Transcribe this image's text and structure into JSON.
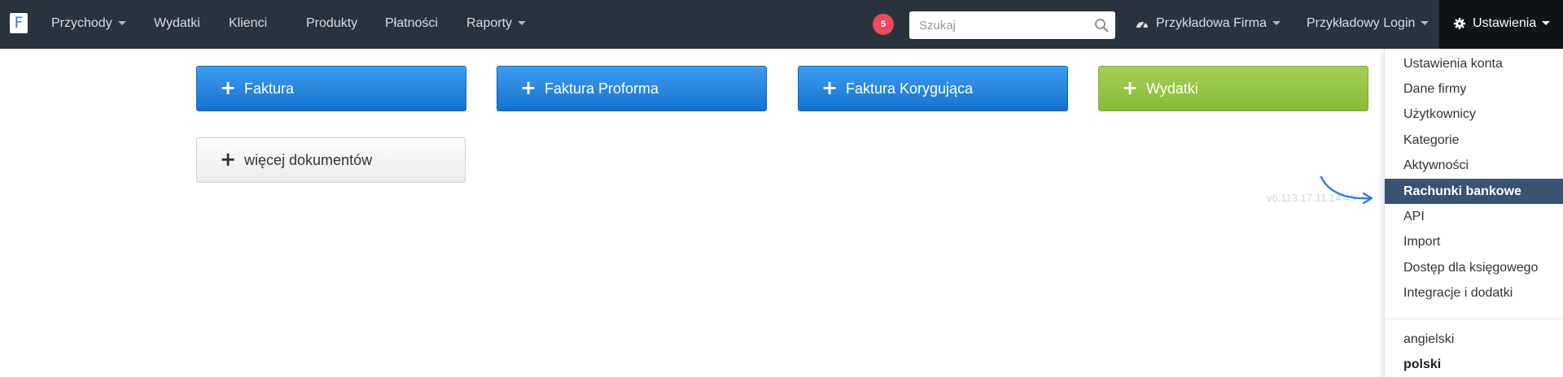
{
  "navbar": {
    "logo_letter": "F",
    "menu": [
      {
        "label": "Przychody",
        "has_caret": true
      },
      {
        "label": "Wydatki",
        "has_caret": false
      },
      {
        "label": "Klienci",
        "has_caret": false
      },
      {
        "label": "Produkty",
        "has_caret": false
      },
      {
        "label": "Płatności",
        "has_caret": false
      },
      {
        "label": "Raporty",
        "has_caret": true
      }
    ],
    "notification_count": "5",
    "search": {
      "placeholder": "Szukaj",
      "value": ""
    },
    "company": {
      "label": "Przykładowa Firma",
      "icon": "dashboard-icon"
    },
    "login": {
      "label": "Przykładowy Login"
    },
    "settings": {
      "label": "Ustawienia",
      "icon": "gear-icon"
    }
  },
  "actions": {
    "primary": [
      {
        "label": "Faktura",
        "color": "#1f82dc"
      },
      {
        "label": "Faktura Proforma",
        "color": "#1f82dc"
      },
      {
        "label": "Faktura Korygująca",
        "color": "#1f82dc"
      },
      {
        "label": "Wydatki",
        "color": "#94c247"
      }
    ],
    "more": {
      "label": "więcej dokumentów"
    }
  },
  "version_text": "v6.113.17.11.14.45",
  "settings_menu": {
    "items": [
      {
        "label": "Ustawienia konta",
        "active": false
      },
      {
        "label": "Dane firmy",
        "active": false
      },
      {
        "label": "Użytkownicy",
        "active": false
      },
      {
        "label": "Kategorie",
        "active": false
      },
      {
        "label": "Aktywności",
        "active": false
      },
      {
        "label": "Rachunki bankowe",
        "active": true
      },
      {
        "label": "API",
        "active": false
      },
      {
        "label": "Import",
        "active": false
      },
      {
        "label": "Dostęp dla księgowego",
        "active": false
      },
      {
        "label": "Integracje i dodatki",
        "active": false
      }
    ],
    "languages": [
      {
        "label": "angielski",
        "selected": false
      },
      {
        "label": "polski",
        "selected": true
      }
    ]
  },
  "colors": {
    "navbar_bg": "#2a323d",
    "active_item_bg": "#3a5171",
    "badge": "#e84c5d",
    "arrow": "#2d7fd9"
  }
}
